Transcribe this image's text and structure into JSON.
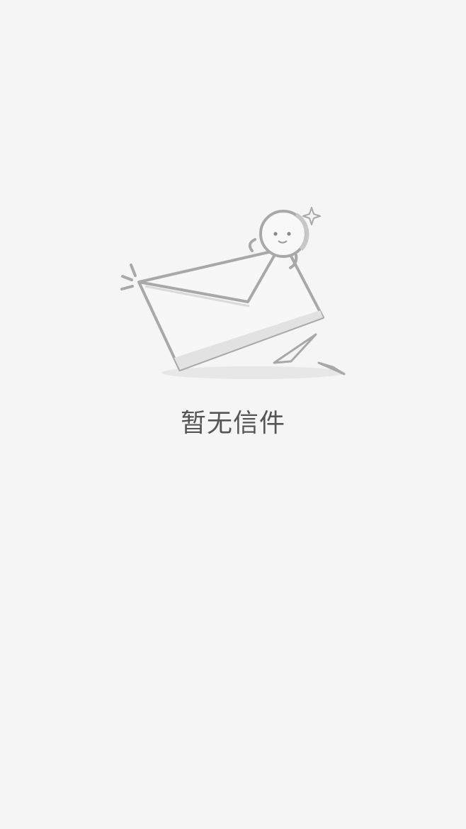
{
  "empty_state": {
    "message": "暂无信件",
    "illustration_icon": "envelope-with-smiley-icon"
  },
  "colors": {
    "background": "#f5f5f5",
    "text": "#555555",
    "line": "#a6a6a6",
    "shadow": "#e8e8e8"
  }
}
